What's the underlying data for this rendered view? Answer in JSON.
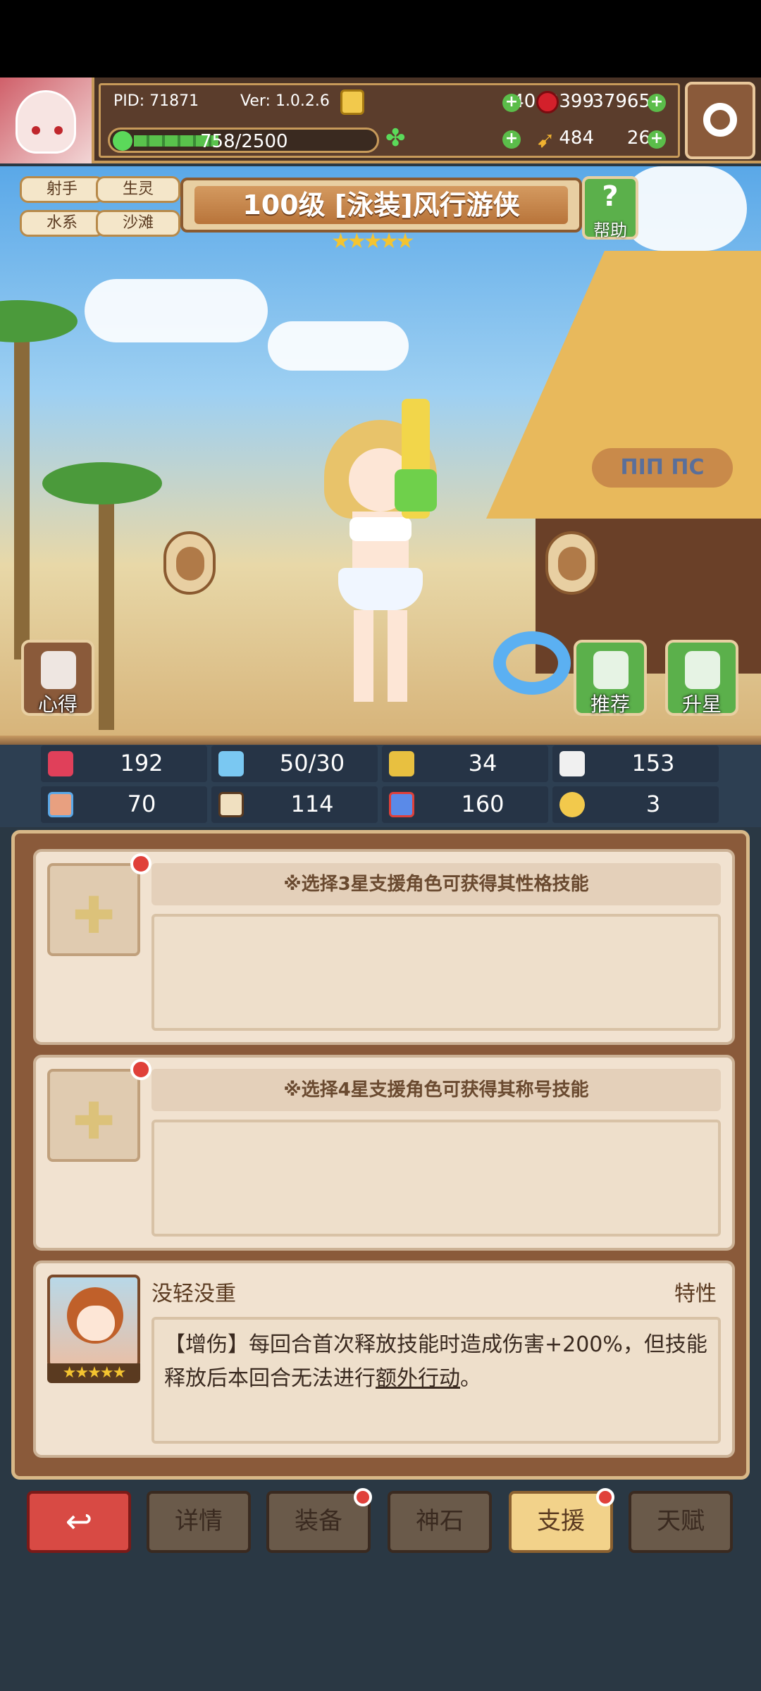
{
  "header": {
    "pid": "PID: 71871",
    "version": "Ver: 1.0.2.6",
    "gold": "4042399",
    "gems": "37965",
    "energy": "758/2500",
    "clover": "484",
    "bolt": "26"
  },
  "hero": {
    "tags": [
      "射手",
      "生灵",
      "水系",
      "沙滩"
    ],
    "title": "100级 [泳装]风行游侠",
    "stars": "★★★★★",
    "help_label": "帮助",
    "sign_text": "ΠΙΠ ΠC"
  },
  "actions": {
    "notes": "心得",
    "recommend": "推荐",
    "star_up": "升星"
  },
  "stats": {
    "hp": "192",
    "mana": "50/30",
    "defense": "34",
    "speed": "153",
    "attack": "70",
    "magic": "114",
    "luck": "160",
    "extra": "3"
  },
  "support": {
    "slot1_hint": "※选择3星支援角色可获得其性格技能",
    "slot2_hint": "※选择4星支援角色可获得其称号技能",
    "skill_name": "没轻没重",
    "skill_type": "特性",
    "skill_desc_a": "【增伤】每回合首次释放技能时造成伤害+200%，但技能释放后本回合无法进行",
    "skill_desc_b": "额外行动",
    "skill_desc_c": "。",
    "portrait_stars": "★★★★★"
  },
  "nav": {
    "back": "↩",
    "details": "详情",
    "equip": "装备",
    "stone": "神石",
    "support": "支援",
    "talent": "天赋"
  },
  "colors": {
    "accent_gold": "#c79a5a",
    "active_tab": "#f2d28a",
    "back_button": "#d84a44",
    "badge_red": "#e0403a"
  }
}
